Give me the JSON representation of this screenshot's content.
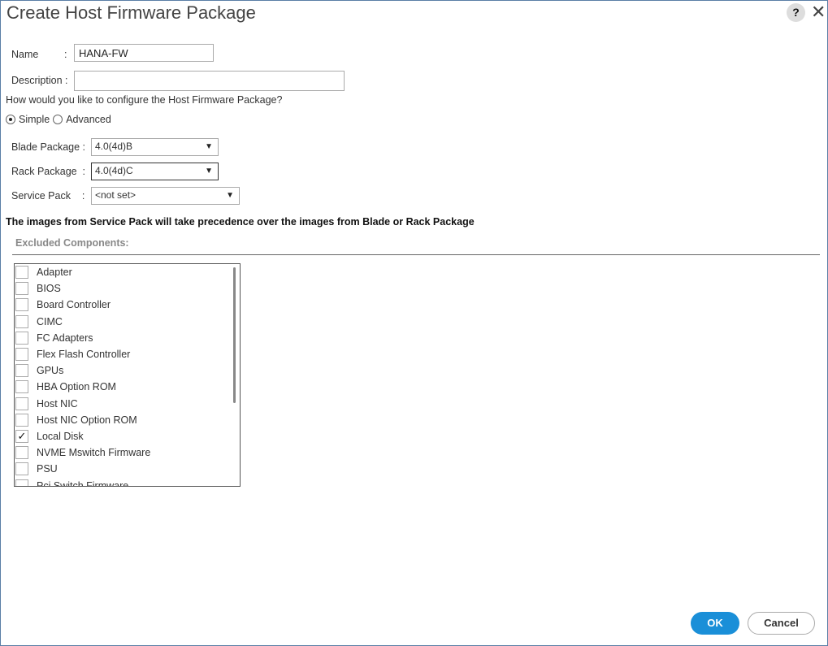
{
  "dialog": {
    "title": "Create Host Firmware Package",
    "help_label": "?",
    "close_label": "✕"
  },
  "form": {
    "name_label": "Name",
    "name_colon": ":",
    "name_value": "HANA-FW",
    "description_label": "Description :",
    "description_value": "",
    "config_question": "How would you like to configure the Host Firmware Package?",
    "mode_options": [
      "Simple",
      "Advanced"
    ],
    "mode_selected": "Simple",
    "blade_package_label": "Blade Package :",
    "blade_package_value": "4.0(4d)B",
    "rack_package_label": "Rack Package  :",
    "rack_package_value": "4.0(4d)C",
    "service_pack_label": "Service Pack    :",
    "service_pack_value": "<not set>",
    "dropdown_arrow": "▼"
  },
  "note": "The images from Service Pack will take precedence over the images from Blade or Rack Package",
  "excluded": {
    "label": "Excluded Components:",
    "items": [
      {
        "label": "Adapter",
        "checked": false
      },
      {
        "label": "BIOS",
        "checked": false
      },
      {
        "label": "Board Controller",
        "checked": false
      },
      {
        "label": "CIMC",
        "checked": false
      },
      {
        "label": "FC Adapters",
        "checked": false
      },
      {
        "label": "Flex Flash Controller",
        "checked": false
      },
      {
        "label": "GPUs",
        "checked": false
      },
      {
        "label": "HBA Option ROM",
        "checked": false
      },
      {
        "label": "Host NIC",
        "checked": false
      },
      {
        "label": "Host NIC Option ROM",
        "checked": false
      },
      {
        "label": "Local Disk",
        "checked": true
      },
      {
        "label": "NVME Mswitch Firmware",
        "checked": false
      },
      {
        "label": "PSU",
        "checked": false
      },
      {
        "label": "Pci Switch Firmware",
        "checked": false
      }
    ]
  },
  "buttons": {
    "ok": "OK",
    "cancel": "Cancel"
  },
  "colors": {
    "primary": "#1a8fd8",
    "frame_border": "#5a7ea6"
  }
}
